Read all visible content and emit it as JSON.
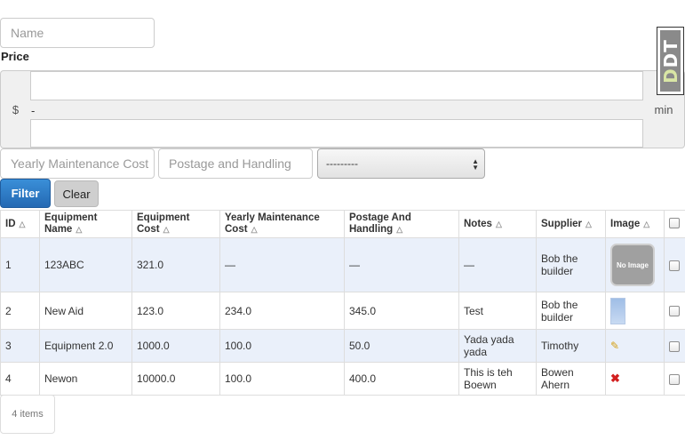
{
  "filters": {
    "name_placeholder": "Name",
    "price_label": "Price",
    "price_prefix": "$",
    "price_separator": "-",
    "price_suffix": "min",
    "yearly_placeholder": "Yearly Maintenance Cost",
    "postage_placeholder": "Postage and Handling",
    "supplier_select_value": "---------",
    "filter_button": "Filter",
    "clear_button": "Clear"
  },
  "logo": {
    "part1": "D",
    "part2": "DT"
  },
  "table": {
    "headers": [
      "ID",
      "Equipment Name",
      "Equipment Cost",
      "Yearly Maintenance Cost",
      "Postage And Handling",
      "Notes",
      "Supplier",
      "Image"
    ],
    "rows": [
      {
        "id": "1",
        "name": "123ABC",
        "cost": "321.0",
        "yearly": "—",
        "postage": "—",
        "notes": "—",
        "supplier": "Bob the builder",
        "image": "No Image"
      },
      {
        "id": "2",
        "name": "New Aid",
        "cost": "123.0",
        "yearly": "234.0",
        "postage": "345.0",
        "notes": "Test",
        "supplier": "Bob the builder",
        "image": "thumbnail"
      },
      {
        "id": "3",
        "name": "Equipment 2.0",
        "cost": "1000.0",
        "yearly": "100.0",
        "postage": "50.0",
        "notes": "Yada yada yada",
        "supplier": "Timothy",
        "image": "pencil-icon"
      },
      {
        "id": "4",
        "name": "Newon",
        "cost": "10000.0",
        "yearly": "100.0",
        "postage": "400.0",
        "notes": "This is teh Boewn",
        "supplier": "Bowen Ahern",
        "image": "x-icon"
      }
    ]
  },
  "footer": {
    "count": "4 items"
  },
  "colors": {
    "primary": "#2a77c6",
    "row_highlight": "#eaf0fa",
    "border": "#dddddd"
  }
}
